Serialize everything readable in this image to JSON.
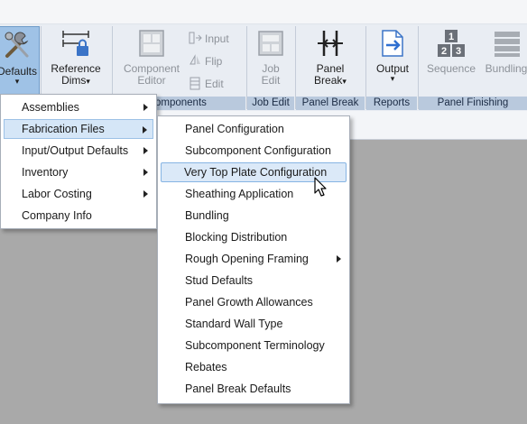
{
  "ribbon": {
    "buttons": {
      "defaults": "Defaults",
      "reference_dims": [
        "Reference",
        "Dims"
      ],
      "component_editor": [
        "Component",
        "Editor"
      ],
      "input": "Input",
      "flip": "Flip",
      "edit": "Edit",
      "job_edit": [
        "Job",
        "Edit"
      ],
      "panel_break": [
        "Panel",
        "Break"
      ],
      "output": "Output",
      "sequence": "Sequence",
      "bundling": "Bundling"
    },
    "groups": {
      "components": "omponents",
      "job_edit": "Job Edit",
      "panel_break": "Panel Break",
      "reports": "Reports",
      "panel_finishing": "Panel Finishing"
    },
    "caret": "▾"
  },
  "menu1": {
    "items": [
      {
        "label": "Assemblies",
        "submenu": true
      },
      {
        "label": "Fabrication Files",
        "submenu": true
      },
      {
        "label": "Input/Output Defaults",
        "submenu": true
      },
      {
        "label": "Inventory",
        "submenu": true
      },
      {
        "label": "Labor Costing",
        "submenu": true
      },
      {
        "label": "Company Info",
        "submenu": false
      }
    ]
  },
  "menu2": {
    "items": [
      {
        "label": "Panel Configuration",
        "submenu": false
      },
      {
        "label": "Subcomponent Configuration",
        "submenu": false
      },
      {
        "label": "Very Top Plate Configuration",
        "submenu": false
      },
      {
        "label": "Sheathing Application",
        "submenu": false
      },
      {
        "label": "Bundling",
        "submenu": false
      },
      {
        "label": "Blocking Distribution",
        "submenu": false
      },
      {
        "label": "Rough Opening Framing",
        "submenu": true
      },
      {
        "label": "Stud Defaults",
        "submenu": false
      },
      {
        "label": "Panel Growth Allowances",
        "submenu": false
      },
      {
        "label": "Standard Wall Type",
        "submenu": false
      },
      {
        "label": "Subcomponent Terminology",
        "submenu": false
      },
      {
        "label": "Rebates",
        "submenu": false
      },
      {
        "label": "Panel Break Defaults",
        "submenu": false
      }
    ]
  },
  "colors": {
    "ribbon_bg": "#e9edf3",
    "group_label_bg": "#b9c9dd",
    "highlight": "#d5e6f7",
    "workspace": "#a9a9a9"
  }
}
